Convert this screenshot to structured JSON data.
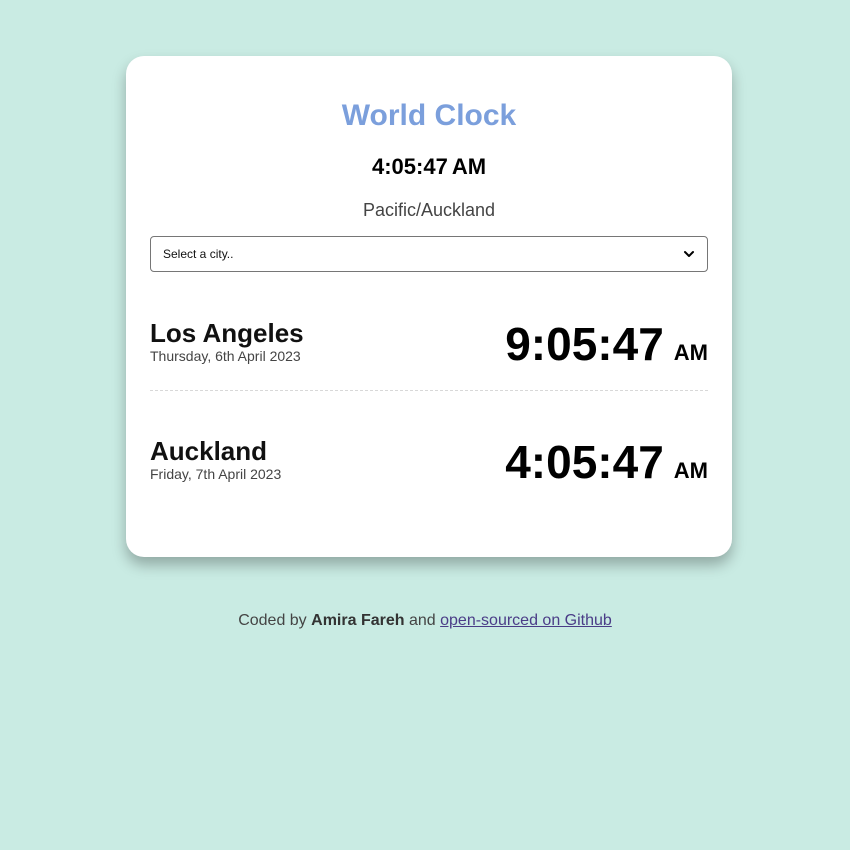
{
  "header": {
    "title": "World Clock"
  },
  "local": {
    "time": "4:05:47",
    "ampm": "AM",
    "zone": "Pacific/Auckland"
  },
  "select": {
    "value": "Select a city.."
  },
  "cities": [
    {
      "name": "Los Angeles",
      "date": "Thursday, 6th April 2023",
      "time": "9:05:47",
      "ampm": "AM"
    },
    {
      "name": "Auckland",
      "date": "Friday, 7th April 2023",
      "time": "4:05:47",
      "ampm": "AM"
    }
  ],
  "footer": {
    "prefix": "Coded by",
    "author": "Amira Fareh",
    "middle": "and",
    "link_text": "open-sourced on Github"
  },
  "colors": {
    "background": "#c9ebe3",
    "title": "#7b9fdc",
    "card": "#ffffff",
    "link": "#4a3c87"
  },
  "icons": {
    "select_arrow": "chevron-down-icon"
  }
}
